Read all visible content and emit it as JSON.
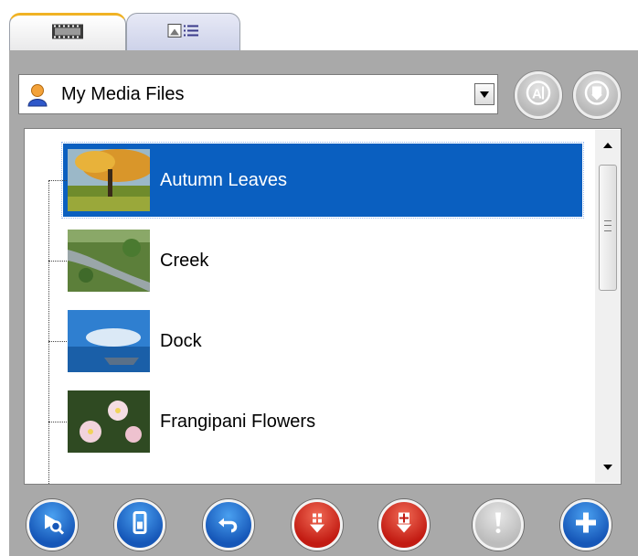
{
  "tabs": [
    {
      "icon": "filmstrip-icon",
      "active": true
    },
    {
      "icon": "details-list-icon",
      "active": false
    }
  ],
  "source_selector": {
    "icon": "user-icon",
    "value": "My Media Files"
  },
  "header_buttons": [
    {
      "icon": "sort-alphabetical-icon"
    },
    {
      "icon": "view-options-icon"
    }
  ],
  "media_items": [
    {
      "label": "Autumn Leaves",
      "selected": true
    },
    {
      "label": "Creek",
      "selected": false
    },
    {
      "label": "Dock",
      "selected": false
    },
    {
      "label": "Frangipani Flowers",
      "selected": false
    }
  ],
  "toolbar": [
    {
      "icon": "preview-search-icon",
      "color": "#1657b8"
    },
    {
      "icon": "copy-icon",
      "color": "#1657b8"
    },
    {
      "icon": "undo-icon",
      "color": "#1657b8"
    },
    {
      "icon": "move-down-one-icon",
      "color": "#c21b12"
    },
    {
      "icon": "move-down-all-icon",
      "color": "#c21b12"
    },
    {
      "icon": "exclamation-icon",
      "color": "#bcbcbc"
    },
    {
      "icon": "add-icon",
      "color": "#1657b8"
    }
  ],
  "colors": {
    "selection": "#0a5fc0",
    "panel": "#a9a9a9",
    "active_tab_accent": "#f0b224"
  }
}
